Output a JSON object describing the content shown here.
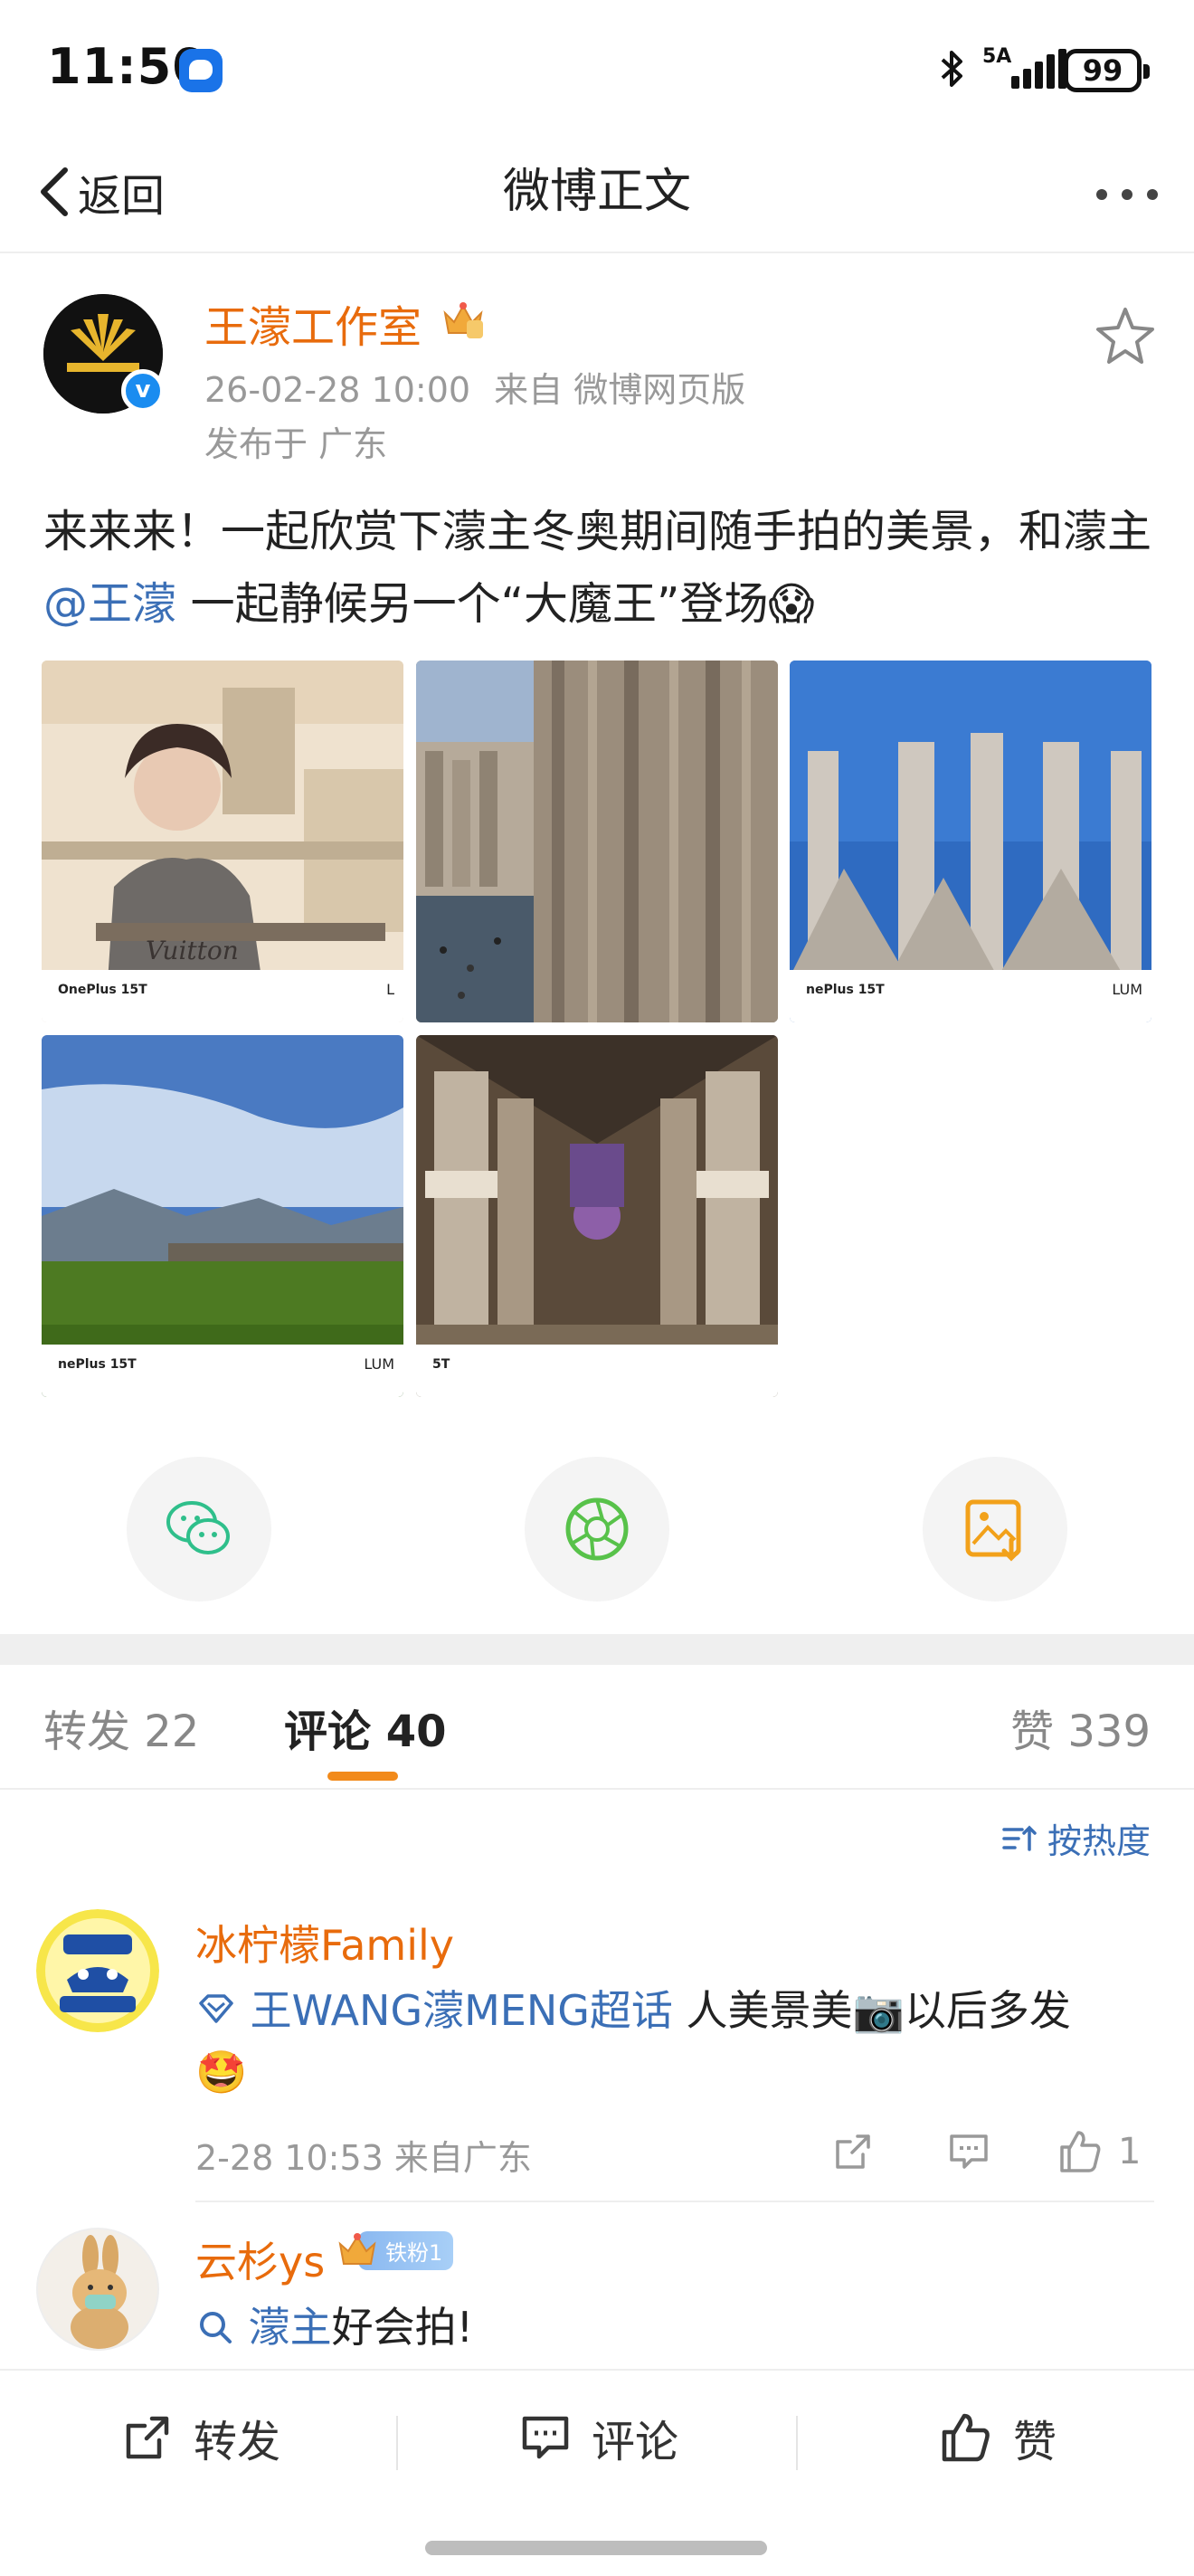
{
  "status_bar": {
    "time": "11:50",
    "network": "5A",
    "battery": "99"
  },
  "nav": {
    "back_label": "返回",
    "title": "微博正文"
  },
  "post": {
    "author": "王濛工作室",
    "timestamp": "26-02-28 10:00",
    "source": "来自 微博网页版",
    "location": "发布于 广东",
    "text_before": "来来来！一起欣赏下濛主冬奥期间随手拍的美景，和濛主",
    "mention": "@王濛",
    "text_after": " 一起静候另一个“大魔王”登场😱",
    "photos": [
      {
        "brand": "OnePlus 15T",
        "brand_right": "L"
      },
      {
        "brand": "",
        "brand_right": ""
      },
      {
        "brand": "nePlus 15T",
        "brand_right": "LUM"
      },
      {
        "brand": "nePlus 15T",
        "brand_right": "LUM"
      },
      {
        "brand": "5T",
        "brand_right": ""
      }
    ]
  },
  "tabs": {
    "repost": "转发 22",
    "comment": "评论 40",
    "like": "赞 339"
  },
  "sort_label": "按热度",
  "comments": [
    {
      "name": "冰柠檬Family",
      "topic": "王WANG濛MENG超话",
      "text": " 人美景美📷以后多发",
      "emoji_line": "🤩",
      "time": "2-28 10:53 来自广东",
      "likes": "1"
    },
    {
      "name": "云杉ys",
      "badge": "铁粉1",
      "topic": "濛主",
      "text": "好会拍!"
    }
  ],
  "bottom_bar": {
    "repost": "转发",
    "comment": "评论",
    "like": "赞"
  },
  "colors": {
    "accent_orange": "#e86b0c",
    "link_blue": "#3b6fb6",
    "tab_indicator": "#f28a1a"
  }
}
